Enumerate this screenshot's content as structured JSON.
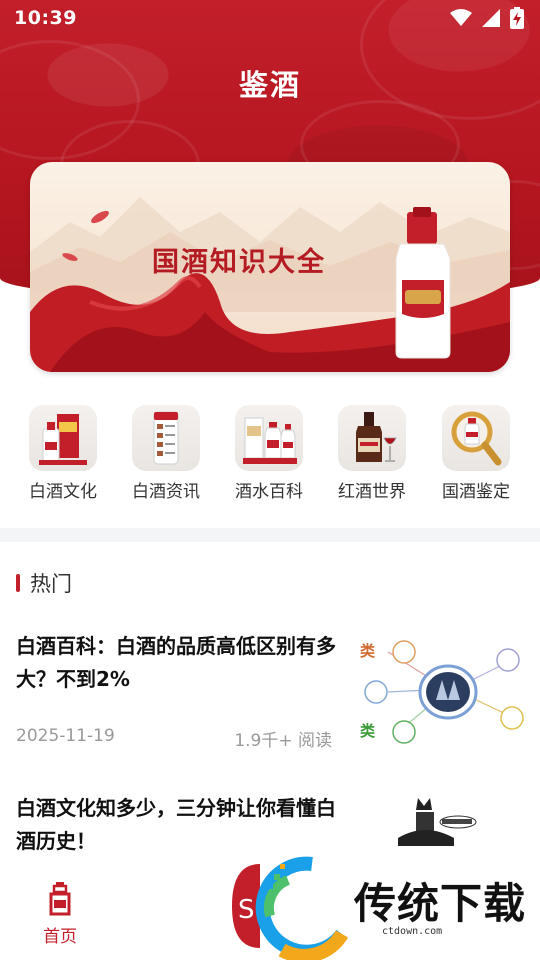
{
  "status_bar": {
    "time": "10:39",
    "icons": [
      "wifi-icon",
      "signal-icon",
      "battery-charging-icon"
    ]
  },
  "page": {
    "title": "鉴酒"
  },
  "banner": {
    "text": "国酒知识大全"
  },
  "categories": [
    {
      "label": "白酒文化",
      "icon": "baijiu-culture-icon"
    },
    {
      "label": "白酒资讯",
      "icon": "baijiu-news-icon"
    },
    {
      "label": "酒水百科",
      "icon": "liquor-encyclopedia-icon"
    },
    {
      "label": "红酒世界",
      "icon": "wine-world-icon"
    },
    {
      "label": "国酒鉴定",
      "icon": "liquor-authentication-icon"
    }
  ],
  "hot": {
    "title": "热门",
    "articles": [
      {
        "title": "白酒百科：白酒的品质高低区别有多大？不到2%",
        "date": "2025-11-19",
        "reads": "1.9千+ 阅读"
      },
      {
        "title": "白酒文化知多少，三分钟让你看懂白酒历史！"
      }
    ]
  },
  "bottom_nav": {
    "home_label": "首页"
  },
  "watermark": {
    "text": "传统下载",
    "url": "ctdown.com"
  },
  "colors": {
    "brand_red": "#c21f2a",
    "text_dark": "#111111",
    "text_muted": "#999999"
  }
}
